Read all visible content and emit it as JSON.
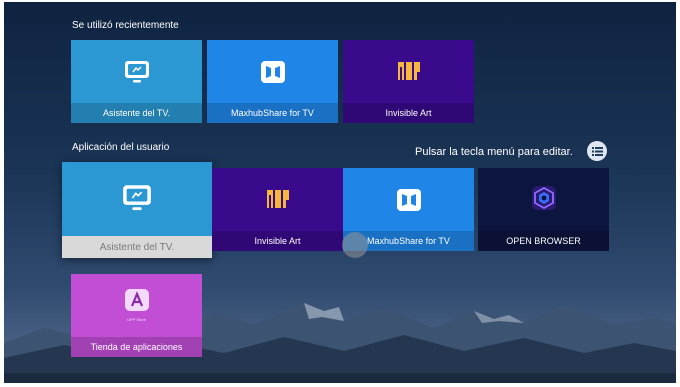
{
  "sections": {
    "recent": {
      "title": "Se utilizó recientemente"
    },
    "user_apps": {
      "title": "Aplicación del usuario"
    }
  },
  "hint": {
    "text": "Pulsar la tecla menú para editar."
  },
  "recent_apps": [
    {
      "label": "Asistente del TV.",
      "color": "#2b98d3",
      "icon": "tv-assistant-icon"
    },
    {
      "label": "MaxhubShare for TV",
      "color": "#1f86e8",
      "icon": "maxhub-share-icon"
    },
    {
      "label": "Invisible Art",
      "color": "#3a0a8c",
      "icon": "invisible-art-icon"
    }
  ],
  "user_apps": [
    {
      "label": "Asistente del TV.",
      "color": "#2b98d3",
      "icon": "tv-assistant-icon",
      "focused": true
    },
    {
      "label": "Invisible Art",
      "color": "#3a0a8c",
      "icon": "invisible-art-icon"
    },
    {
      "label": "MaxhubShare for TV",
      "color": "#1f86e8",
      "icon": "maxhub-share-icon"
    },
    {
      "label": "OPEN BROWSER",
      "color": "#0c1540",
      "icon": "open-browser-icon"
    },
    {
      "label": "Tienda de aplicaciones",
      "color": "#c24ed6",
      "icon": "app-store-icon",
      "icon_text": "OPP Store"
    }
  ]
}
